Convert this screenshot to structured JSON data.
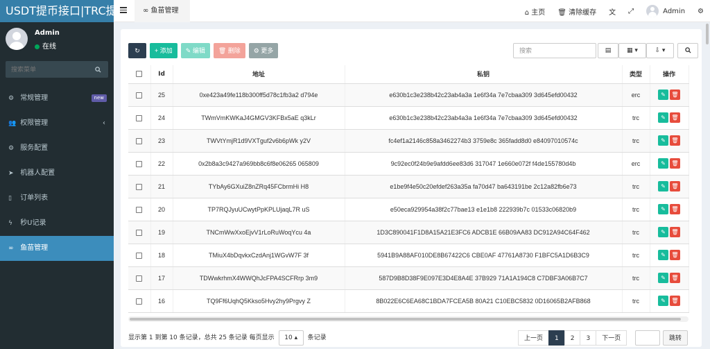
{
  "brand": "USDT提币接口|TRC提",
  "user": {
    "name": "Admin",
    "status": "在线"
  },
  "sidebar": {
    "search_placeholder": "搜索菜单",
    "items": [
      {
        "icon": "gears-icon",
        "label": "常规管理",
        "badge": "new"
      },
      {
        "icon": "users-icon",
        "label": "权限管理",
        "chevron": "‹"
      },
      {
        "icon": "gear-icon",
        "label": "服务配置"
      },
      {
        "icon": "paper-plane-icon",
        "label": "机器人配置"
      },
      {
        "icon": "bookmark-icon",
        "label": "订单列表"
      },
      {
        "icon": "bolt-icon",
        "label": "秒U记录"
      },
      {
        "icon": "mask-icon",
        "label": "鱼苗管理",
        "active": true
      }
    ]
  },
  "topbar": {
    "tab": "鱼苗管理",
    "home": "主页",
    "clear_cache": "清除缓存",
    "user": "Admin"
  },
  "toolbar": {
    "add": "添加",
    "edit": "编辑",
    "delete": "删除",
    "more": "更多",
    "search_placeholder": "搜索"
  },
  "table": {
    "columns": [
      "",
      "Id",
      "地址",
      "私钥",
      "类型",
      "操作"
    ],
    "rows": [
      {
        "id": "25",
        "address": "0xe423a49fe118b300ff5d78c1fb3a2 d794e",
        "key": "e630b1c3e238b42c23ab4a3a 1e6f34a 7e7cbaa309 3d645efd00432",
        "type": "erc"
      },
      {
        "id": "24",
        "address": "TWmVmKWKaJ4GMGV3KFBx5aE q3kLr",
        "key": "e630b1c3e238b42c23ab4a3a 1e6f34a 7e7cbaa309 3d645efd00432",
        "type": "trc"
      },
      {
        "id": "23",
        "address": "TWVtYmjR1d9VXTguf2v6b6pWk y2V",
        "key": "fc4ef1a2146c858a3462274b3 3759e8c 365fadd8d0 e84097010574c",
        "type": "trc"
      },
      {
        "id": "22",
        "address": "0x2b8a3c9427a969bb8c6f8e06265 065809",
        "key": "9c92ec0f24b9e9afdd6ee83d6 317047 1e660e072f f4de155780d4b",
        "type": "erc"
      },
      {
        "id": "21",
        "address": "TYbAy6GXuiZ8nZRq45FCbrmHi H8",
        "key": "e1be9f4e50c20efdef263a35a fa70d47 ba643191be 2c12a82fb6e73",
        "type": "trc"
      },
      {
        "id": "20",
        "address": "TP7RQJyuUCwytPpKPLUjaqL7R uS",
        "key": "e50eca929954a38f2c77bae13 e1e1b8 222939b7c 01533c06820b9",
        "type": "trc"
      },
      {
        "id": "19",
        "address": "TNCmWwXxoEjvV1rLoRuWoqYcu 4a",
        "key": "1D3C890041F1D8A15A21E3FC6 ADCB1E 66B09AA83 DC912A94C64F462",
        "type": "trc"
      },
      {
        "id": "18",
        "address": "TMiuX4bDqvkxCzdAnj1WGvW7F 3f",
        "key": "5941B9A88AF010DE8B67422C6 CBE0AF 47761A8730 F1BFC5A1D6B3C9",
        "type": "trc"
      },
      {
        "id": "17",
        "address": "TDWwkrhmX4WWQhJcFPA4SCFRrp 3m9",
        "key": "587D9B8D38F9E097E3D4E8A4E 37B929 71A1A194C8 C7DBF3A06B7C7",
        "type": "trc"
      },
      {
        "id": "16",
        "address": "TQ9Ff6UqhQ5Kkso5Hvy2hy9Prgvy Z",
        "key": "8B022E6C6EA68C1BDA7FCEA5B 80A21 C10EBC5832 0D16065B2AFB868",
        "type": "trc"
      }
    ]
  },
  "footer": {
    "info_prefix": "显示第 1 到第 10 条记录，总共 25 条记录 每页显示",
    "page_size": "10",
    "info_suffix": "条记录",
    "prev": "上一页",
    "pages": [
      "1",
      "2",
      "3"
    ],
    "next": "下一页",
    "jump": "跳转"
  }
}
